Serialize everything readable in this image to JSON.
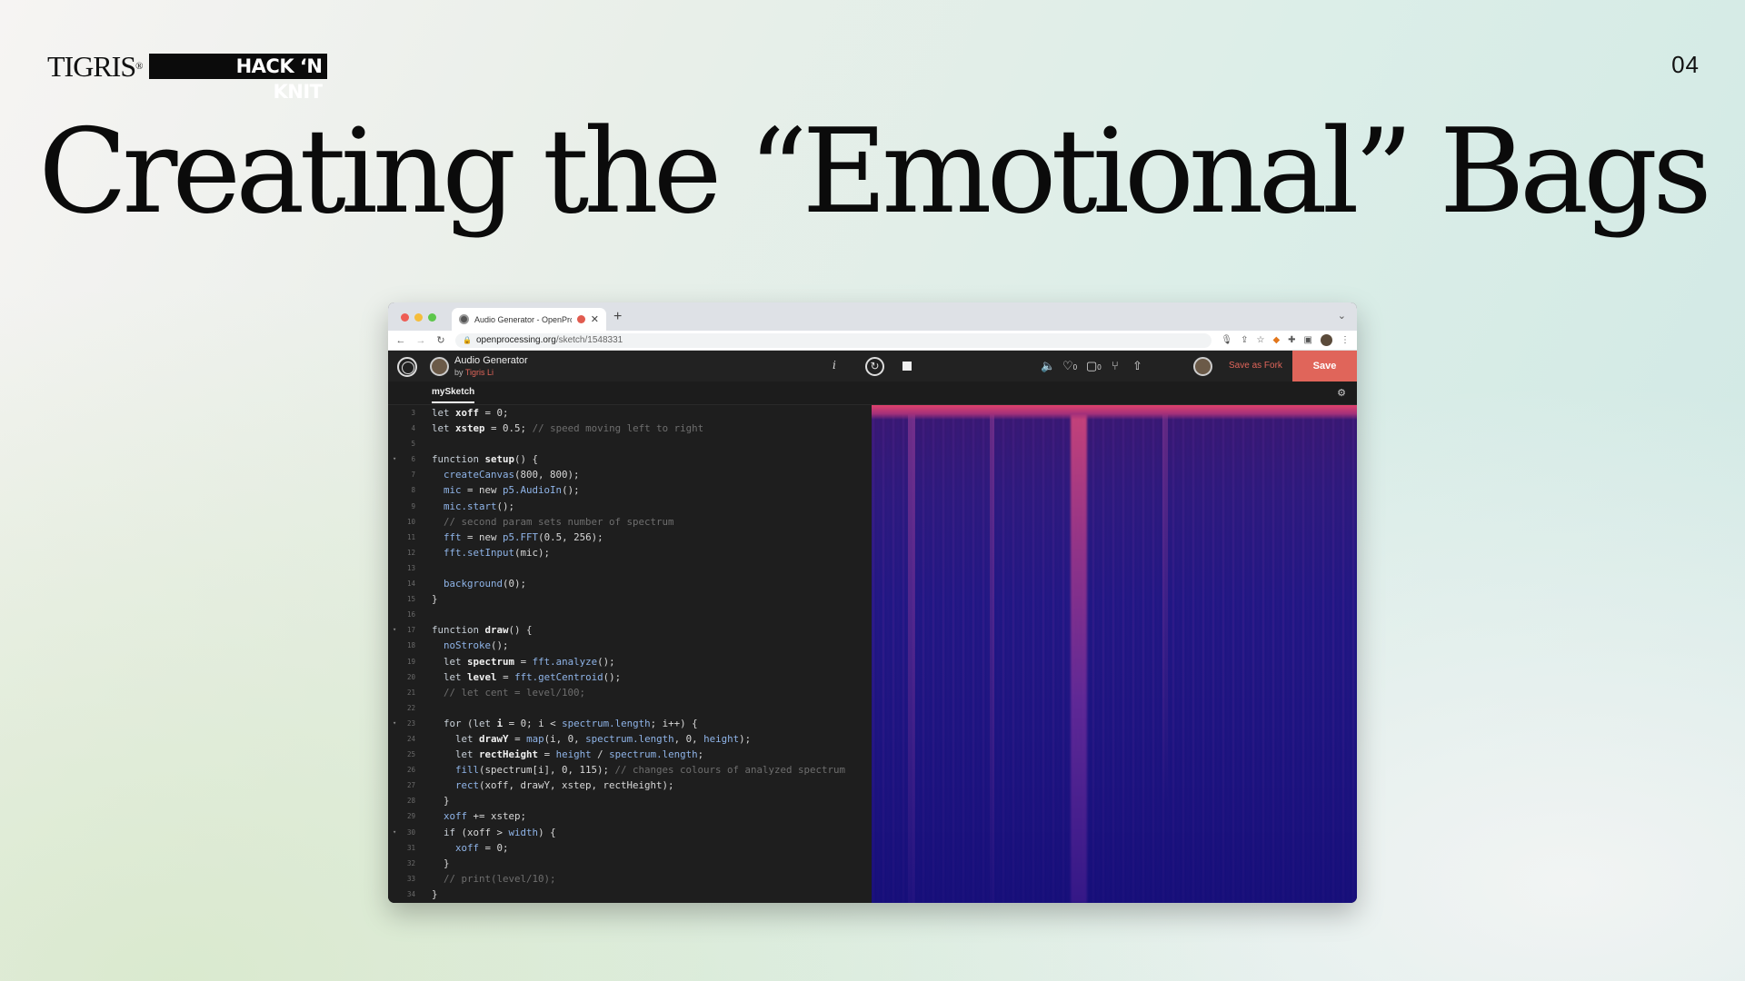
{
  "slide": {
    "brand_tigris": "TIGRIS",
    "brand_tigris_mark": "®",
    "brand_hack": "HACK ‘N KNIT",
    "page_number": "04",
    "title": "Creating the “Emotional” Bags"
  },
  "browser": {
    "tab_title": "Audio Generator - OpenProcessing",
    "new_tab_symbol": "+",
    "url_domain": "openprocessing.org",
    "url_path": "/sketch/1548331"
  },
  "toolbar": {
    "sketch_name": "Audio Generator",
    "by_prefix": "by",
    "author": "Tigris Li",
    "info_label": "i",
    "likes_count": "0",
    "comments_count": "0",
    "save_as_fork_label": "Save as Fork",
    "save_label": "Save"
  },
  "editor": {
    "file_tab": "mySketch",
    "lines": [
      {
        "n": "3",
        "fold": false,
        "html": "<span class=\"kw\">let</span> <span class=\"vr\">xoff</span> = 0;"
      },
      {
        "n": "4",
        "fold": false,
        "html": "<span class=\"kw\">let</span> <span class=\"vr\">xstep</span> = 0.5; <span class=\"cm\">// speed moving left to right</span>"
      },
      {
        "n": "5",
        "fold": false,
        "html": ""
      },
      {
        "n": "6",
        "fold": true,
        "html": "<span class=\"kw\">function</span> <span class=\"vr\">setup</span>() {"
      },
      {
        "n": "7",
        "fold": false,
        "html": "  <span class=\"fn\">createCanvas</span>(800, 800);"
      },
      {
        "n": "8",
        "fold": false,
        "html": "  <span class=\"fn\">mic</span> = new <span class=\"fn\">p5.AudioIn</span>();"
      },
      {
        "n": "9",
        "fold": false,
        "html": "  <span class=\"fn\">mic.start</span>();"
      },
      {
        "n": "10",
        "fold": false,
        "html": "  <span class=\"cm\">// second param sets number of spectrum</span>"
      },
      {
        "n": "11",
        "fold": false,
        "html": "  <span class=\"fn\">fft</span> = new <span class=\"fn\">p5.FFT</span>(0.5, 256);"
      },
      {
        "n": "12",
        "fold": false,
        "html": "  <span class=\"fn\">fft.setInput</span>(mic);"
      },
      {
        "n": "13",
        "fold": false,
        "html": ""
      },
      {
        "n": "14",
        "fold": false,
        "html": "  <span class=\"fn\">background</span>(0);"
      },
      {
        "n": "15",
        "fold": false,
        "html": "}"
      },
      {
        "n": "16",
        "fold": false,
        "html": ""
      },
      {
        "n": "17",
        "fold": true,
        "html": "<span class=\"kw\">function</span> <span class=\"vr\">draw</span>() {"
      },
      {
        "n": "18",
        "fold": false,
        "html": "  <span class=\"fn\">noStroke</span>();"
      },
      {
        "n": "19",
        "fold": false,
        "html": "  <span class=\"kw\">let</span> <span class=\"vr\">spectrum</span> = <span class=\"fn\">fft.analyze</span>();"
      },
      {
        "n": "20",
        "fold": false,
        "html": "  <span class=\"kw\">let</span> <span class=\"vr\">level</span> = <span class=\"fn\">fft.getCentroid</span>();"
      },
      {
        "n": "21",
        "fold": false,
        "html": "  <span class=\"cm\">// let cent = level/100;</span>"
      },
      {
        "n": "22",
        "fold": false,
        "html": ""
      },
      {
        "n": "23",
        "fold": true,
        "html": "  <span class=\"kw\">for</span> (<span class=\"kw\">let</span> <span class=\"vr\">i</span> = 0; i &lt; <span class=\"fn\">spectrum.length</span>; i++) {"
      },
      {
        "n": "24",
        "fold": false,
        "html": "    <span class=\"kw\">let</span> <span class=\"vr\">drawY</span> = <span class=\"fn\">map</span>(i, 0, <span class=\"fn\">spectrum.length</span>, 0, <span class=\"fn\">height</span>);"
      },
      {
        "n": "25",
        "fold": false,
        "html": "    <span class=\"kw\">let</span> <span class=\"vr\">rectHeight</span> = <span class=\"fn\">height</span> / <span class=\"fn\">spectrum.length</span>;"
      },
      {
        "n": "26",
        "fold": false,
        "html": "    <span class=\"fn\">fill</span>(spectrum[i], 0, 115); <span class=\"cm\">// changes colours of analyzed spectrum</span>"
      },
      {
        "n": "27",
        "fold": false,
        "html": "    <span class=\"fn\">rect</span>(xoff, drawY, xstep, rectHeight);"
      },
      {
        "n": "28",
        "fold": false,
        "html": "  }"
      },
      {
        "n": "29",
        "fold": false,
        "html": "  <span class=\"fn\">xoff</span> += xstep;"
      },
      {
        "n": "30",
        "fold": true,
        "html": "  <span class=\"kw\">if</span> (xoff &gt; <span class=\"fn\">width</span>) {"
      },
      {
        "n": "31",
        "fold": false,
        "html": "    <span class=\"fn\">xoff</span> = 0;"
      },
      {
        "n": "32",
        "fold": false,
        "html": "  }"
      },
      {
        "n": "33",
        "fold": false,
        "html": "  <span class=\"cm\">// print(level/10);</span>"
      },
      {
        "n": "34",
        "fold": false,
        "html": "}"
      }
    ]
  },
  "colors": {
    "accent": "#e0655a",
    "canvas_top": "#e0426c",
    "canvas_base": "#160f7a"
  }
}
